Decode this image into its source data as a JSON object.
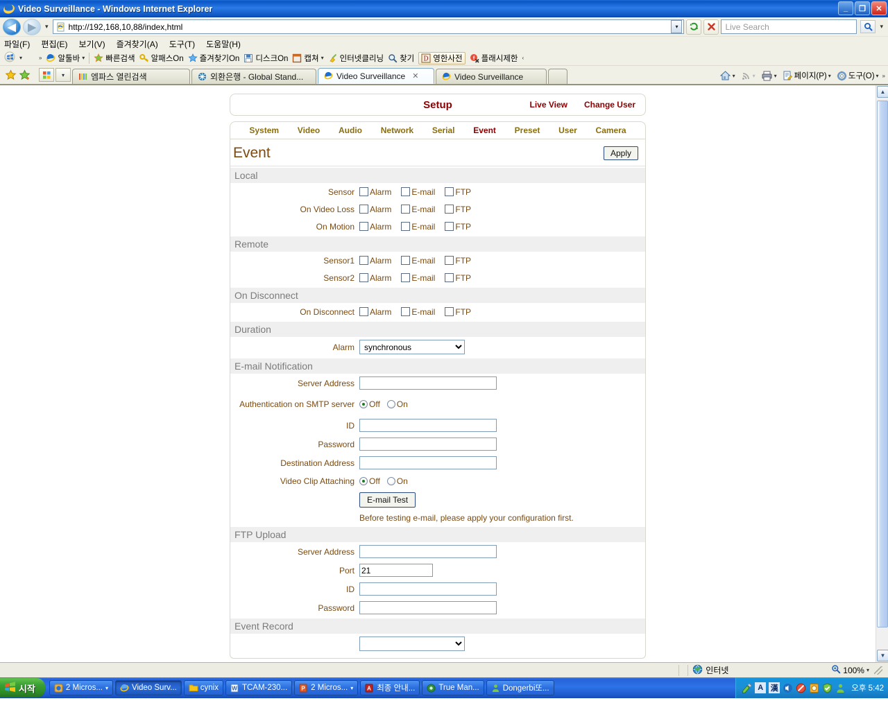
{
  "window": {
    "title": "Video Surveillance - Windows Internet Explorer",
    "minimize_label": "_",
    "maximize_label": "❐",
    "close_label": "✕"
  },
  "address_bar": {
    "url": "http://192,168,10,88/index,html",
    "back_label": "◀",
    "forward_label": "▶",
    "history_caret": "▾",
    "url_caret": "▾",
    "refresh_label": "↻",
    "stop_label": "✕",
    "search_placeholder": "Live Search",
    "search_go_label": "🔍",
    "search_caret": "▾"
  },
  "menu": [
    {
      "label": "파일(F)"
    },
    {
      "label": "편집(E)"
    },
    {
      "label": "보기(V)"
    },
    {
      "label": "즐겨찾기(A)"
    },
    {
      "label": "도구(T)"
    },
    {
      "label": "도움말(H)"
    }
  ],
  "links_toolbar": {
    "overflow_label": "»",
    "collapse_label": "‹",
    "items": [
      {
        "label": "알툴바",
        "icon": "ie-icon",
        "caret": "▾"
      },
      {
        "label": "빠른검색",
        "icon": "star-burst-icon"
      },
      {
        "label": "알패스On",
        "icon": "key-icon"
      },
      {
        "label": "즐겨찾기On",
        "icon": "star-icon"
      },
      {
        "label": "디스크On",
        "icon": "floppy-icon"
      },
      {
        "label": "캡쳐",
        "icon": "capture-icon",
        "caret": "▾"
      },
      {
        "label": "인터넷클리닝",
        "icon": "broom-icon"
      },
      {
        "label": "찾기",
        "icon": "magnifier-icon"
      },
      {
        "label": "영한사전",
        "icon": "dictionary-icon",
        "boxed": true
      },
      {
        "label": "플래시제한",
        "icon": "flash-icon"
      }
    ]
  },
  "tabs": {
    "favorites_icon": "star-gold-icon",
    "add_favorites_icon": "star-plus-icon",
    "quick_tabs_icon": "quick-tabs-icon",
    "tab_list_caret": "▾",
    "items": [
      {
        "label": "엠파스 열린검색",
        "icon": "empas-icon",
        "active": false,
        "closable": false
      },
      {
        "label": "외환은행 - Global Stand...",
        "icon": "keb-icon",
        "active": false,
        "closable": false
      },
      {
        "label": "Video Surveillance",
        "icon": "ie-icon",
        "active": true,
        "closable": true,
        "close_label": "✕"
      },
      {
        "label": "Video Surveillance",
        "icon": "ie-icon",
        "active": false,
        "closable": false
      }
    ],
    "right_buttons": [
      {
        "label": "",
        "icon": "home-icon",
        "caret": "▾"
      },
      {
        "label": "",
        "icon": "feeds-icon",
        "caret": "▾"
      },
      {
        "label": "",
        "icon": "print-icon",
        "caret": "▾"
      },
      {
        "label": "페이지(P)",
        "icon": "page-icon",
        "caret": "▾"
      },
      {
        "label": "도구(O)",
        "icon": "gear-icon",
        "caret": "▾"
      }
    ],
    "overflow_label": "»"
  },
  "page": {
    "header": {
      "title": "Setup",
      "live_view": "Live View",
      "change_user": "Change User"
    },
    "nav_tabs": [
      {
        "label": "System",
        "active": false
      },
      {
        "label": "Video",
        "active": false
      },
      {
        "label": "Audio",
        "active": false
      },
      {
        "label": "Network",
        "active": false
      },
      {
        "label": "Serial",
        "active": false
      },
      {
        "label": "Event",
        "active": true
      },
      {
        "label": "Preset",
        "active": false
      },
      {
        "label": "User",
        "active": false
      },
      {
        "label": "Camera",
        "active": false
      }
    ],
    "title": "Event",
    "apply_label": "Apply",
    "sections": {
      "local": {
        "heading": "Local",
        "rows": [
          {
            "label": "Sensor",
            "checks": [
              {
                "label": "Alarm",
                "checked": false
              },
              {
                "label": "E-mail",
                "checked": false
              },
              {
                "label": "FTP",
                "checked": false
              }
            ]
          },
          {
            "label": "On Video Loss",
            "checks": [
              {
                "label": "Alarm",
                "checked": false
              },
              {
                "label": "E-mail",
                "checked": false
              },
              {
                "label": "FTP",
                "checked": false
              }
            ]
          },
          {
            "label": "On Motion",
            "checks": [
              {
                "label": "Alarm",
                "checked": false
              },
              {
                "label": "E-mail",
                "checked": false
              },
              {
                "label": "FTP",
                "checked": false
              }
            ]
          }
        ]
      },
      "remote": {
        "heading": "Remote",
        "rows": [
          {
            "label": "Sensor1",
            "checks": [
              {
                "label": "Alarm",
                "checked": false
              },
              {
                "label": "E-mail",
                "checked": false
              },
              {
                "label": "FTP",
                "checked": false
              }
            ]
          },
          {
            "label": "Sensor2",
            "checks": [
              {
                "label": "Alarm",
                "checked": false
              },
              {
                "label": "E-mail",
                "checked": false
              },
              {
                "label": "FTP",
                "checked": false
              }
            ]
          }
        ]
      },
      "on_disconnect": {
        "heading": "On Disconnect",
        "rows": [
          {
            "label": "On Disconnect",
            "checks": [
              {
                "label": "Alarm",
                "checked": false
              },
              {
                "label": "E-mail",
                "checked": false
              },
              {
                "label": "FTP",
                "checked": false
              }
            ]
          }
        ]
      },
      "duration": {
        "heading": "Duration",
        "alarm_label": "Alarm",
        "alarm_value": "synchronous",
        "alarm_options": [
          "synchronous"
        ]
      },
      "email": {
        "heading": "E-mail Notification",
        "server_address_label": "Server Address",
        "server_address_value": "",
        "auth_label": "Authentication on SMTP server",
        "auth_off": "Off",
        "auth_on": "On",
        "auth_selected": "Off",
        "id_label": "ID",
        "id_value": "",
        "password_label": "Password",
        "password_value": "",
        "destination_label": "Destination Address",
        "destination_value": "",
        "clip_label": "Video Clip Attaching",
        "clip_off": "Off",
        "clip_on": "On",
        "clip_selected": "Off",
        "test_button": "E-mail Test",
        "note": "Before testing e-mail, please apply your configuration first."
      },
      "ftp": {
        "heading": "FTP Upload",
        "server_address_label": "Server Address",
        "server_address_value": "",
        "port_label": "Port",
        "port_value": "21",
        "id_label": "ID",
        "id_value": "",
        "password_label": "Password",
        "password_value": ""
      },
      "event_record": {
        "heading": "Event Record"
      }
    }
  },
  "scrollbar": {
    "up_label": "▲",
    "down_label": "▼"
  },
  "status_bar": {
    "zone": "인터넷",
    "zone_icon": "globe-icon",
    "zoom": "100%",
    "zoom_icon": "magnifier-plus-icon",
    "zoom_caret": "▾"
  },
  "taskbar": {
    "start_label": "시작",
    "buttons": [
      {
        "label": "2 Micros...",
        "icon": "outlook-icon",
        "active": false,
        "caret": "▾"
      },
      {
        "label": "Video Surv...",
        "icon": "ie-icon",
        "active": true
      },
      {
        "label": "cynix",
        "icon": "folder-icon",
        "active": false
      },
      {
        "label": "TCAM-230...",
        "icon": "word-icon",
        "active": false
      },
      {
        "label": "2 Micros...",
        "icon": "powerpoint-icon",
        "active": false,
        "caret": "▾"
      },
      {
        "label": "최종 안내...",
        "icon": "acrobat-icon",
        "active": false
      },
      {
        "label": "True Man...",
        "icon": "app-icon",
        "active": false
      },
      {
        "label": "Dongerbi또...",
        "icon": "messenger-icon",
        "active": false
      }
    ],
    "tray": {
      "icons": [
        "paint-icon",
        "ime-a-icon",
        "ime-hanja-icon",
        "volume-icon",
        "block-icon",
        "update-icon",
        "shield-icon",
        "messenger-icon"
      ],
      "ime_a": "A",
      "ime_hanja": "漢",
      "clock": "오후 5:42"
    }
  }
}
